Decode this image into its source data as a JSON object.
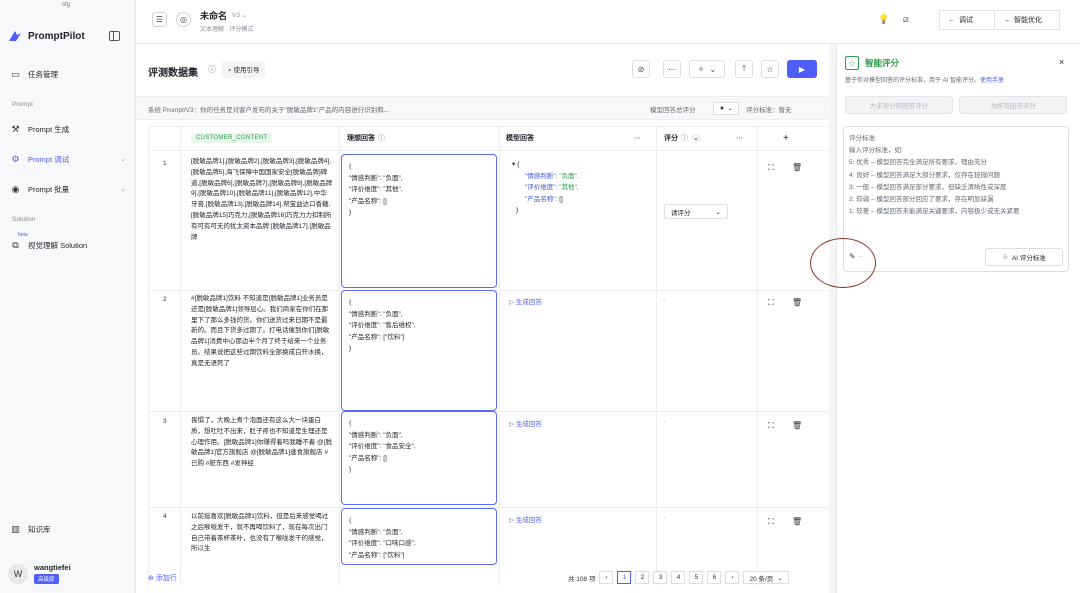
{
  "sidebar": {
    "org": "sfg",
    "logo": "PromptPilot",
    "items": [
      {
        "label": "任务管理",
        "icon": "task-icon"
      },
      {
        "label": "Prompt 生成",
        "icon": "generate-icon"
      },
      {
        "label": "Prompt 调试",
        "icon": "debug-icon"
      },
      {
        "label": "Prompt 批量",
        "icon": "batch-icon"
      },
      {
        "label": "视觉理解 Solution",
        "icon": "vision-icon"
      },
      {
        "label": "知识库",
        "icon": "book-icon"
      }
    ],
    "section_prompt": "Prompt",
    "section_solution": "Solution",
    "beta": "beta",
    "user": {
      "initial": "W",
      "name": "wangtiefei",
      "badge": "高级版"
    }
  },
  "topbar": {
    "name": "未命名",
    "version": "V3",
    "subtitle": "文本理解 · 评分模式",
    "debug": "调试",
    "optimize": "智能优化"
  },
  "main": {
    "title": "评测数据集",
    "guide": "使用引导",
    "system_prompt": "系统 Prompt/V3：你的任务是对客户发布的关于\"脱敏品牌1\"产品的内容进行识别和...",
    "model_eval": "模型回答总评分",
    "score_standard": "评分标准：暂无",
    "headers": {
      "customer_content": "CUSTOMER_CONTENT",
      "ideal": "理想回答",
      "model": "模型回答",
      "score": "评分"
    },
    "rows": [
      {
        "num": "1",
        "content": "[脱敏品牌1],[脱敏品牌2],[脱敏品牌3],[脱敏品牌4],[脱敏品牌5],海飞保障中国国家安全[脱敏品牌]碑道,[脱敏品牌6],[脱敏品牌7],[脱敏品牌8],[脱敏品牌9],[脱敏品牌10],[脱敏品牌11],[脱敏品牌12],中华牙膏,[脱敏品牌13],[脱敏品牌14],帮宝益达口香糖,[脱敏品牌15]巧克力,[脱敏品牌16]巧克力力扣制所有可有可无的犹太资本品牌:[脱敏品牌17],[脱敏品牌",
        "ideal": [
          "{",
          "\"情感判断\": \"负面\",",
          "\"评价维度\": \"其他\",",
          "\"产品名称\": []",
          "}"
        ],
        "model": {
          "k1": "\"情感判断\": ",
          "v1": "\"负面\",",
          "k2": "\"评价维度\": ",
          "v2": "\"其他\",",
          "k3": "\"产品名称\": ",
          "v3": "[]"
        },
        "score": "请评分"
      },
      {
        "num": "2",
        "content": "#[脱敏品牌1]饮料 不知道是[脱敏品牌1]业务员是还是[脱敏品牌1]领导层心。我们商家在你们在那里下了那么多钱的货。你们送货过来日期不是最新的。而且下货多过期了。打电话催到你们[脱敏品牌1]消费中心那边半个月了终于给来一个业务员。结果说把这些过期饮料全部换成白开水换，真是无语死了",
        "ideal": [
          "{",
          "\"情感判断\": \"负面\",",
          "\"评价维度\": \"售后维权\",",
          "\"产品名称\": [\"饮料\"]",
          "}"
        ],
        "gen": "生成回答",
        "score": "-"
      },
      {
        "num": "3",
        "content": "畏惧了，大晚上煮个泡面还有这么大一块蛋白质，想吐吐不出来，肚子疼也不知道是生理还是心理作用。[脱敏品牌1]你赚得着吗我睡不着 @[脱敏品牌1]官方旗舰店 @[脱敏品牌1]速食旗舰店 #已购 #脏东西 #发神经",
        "ideal": [
          "{",
          "\"情感判断\": \"负面\",",
          "\"评价维度\": \"食品安全\",",
          "\"产品名称\": []",
          "}"
        ],
        "gen": "生成回答",
        "score": "-"
      },
      {
        "num": "4",
        "content": "以前挺喜欢[脱敏品牌1]饮料，但是后来感觉喝过之后喉咙发干，就不再喝饮料了，现在每次出门自己带着茶杯茶叶，也没有了喉咙发干的感觉，所以生",
        "ideal": [
          "{",
          "\"情感判断\": \"负面\",",
          "\"评价维度\": \"口味口感\",",
          "\"产品名称\": [\"饮料\"]"
        ],
        "gen": "生成回答",
        "score": "-"
      }
    ],
    "add_row": "添加行",
    "pagination": {
      "total": "共 108 项",
      "pages": [
        "1",
        "2",
        "3",
        "4",
        "5",
        "6"
      ],
      "page_size": "20 条/页"
    }
  },
  "right": {
    "title": "智能评分",
    "desc": "基于你对模型回答的评分标准，用于 AI 智能评分。",
    "manual": "使用手册",
    "btn_unscored": "为未评分的回答评分",
    "btn_all": "为所有回答评分",
    "lines": [
      "评分标准:",
      "输入评分标准，如:",
      "5: 优秀 – 模型回答完全满足所有要求，理由充分",
      "4: 良好 – 模型回答满足大部分要求，仅存在轻微问题",
      "3: 一般 – 模型回答满足部分要求，但缺乏清晰性或深度",
      "2: 较弱 – 模型回答部分回应了要求，存在明显缺漏",
      "1: 较差 – 模型回答未能满足关键要求，内容极少或无关紧要"
    ],
    "ai_standard": "AI 评分标准"
  }
}
